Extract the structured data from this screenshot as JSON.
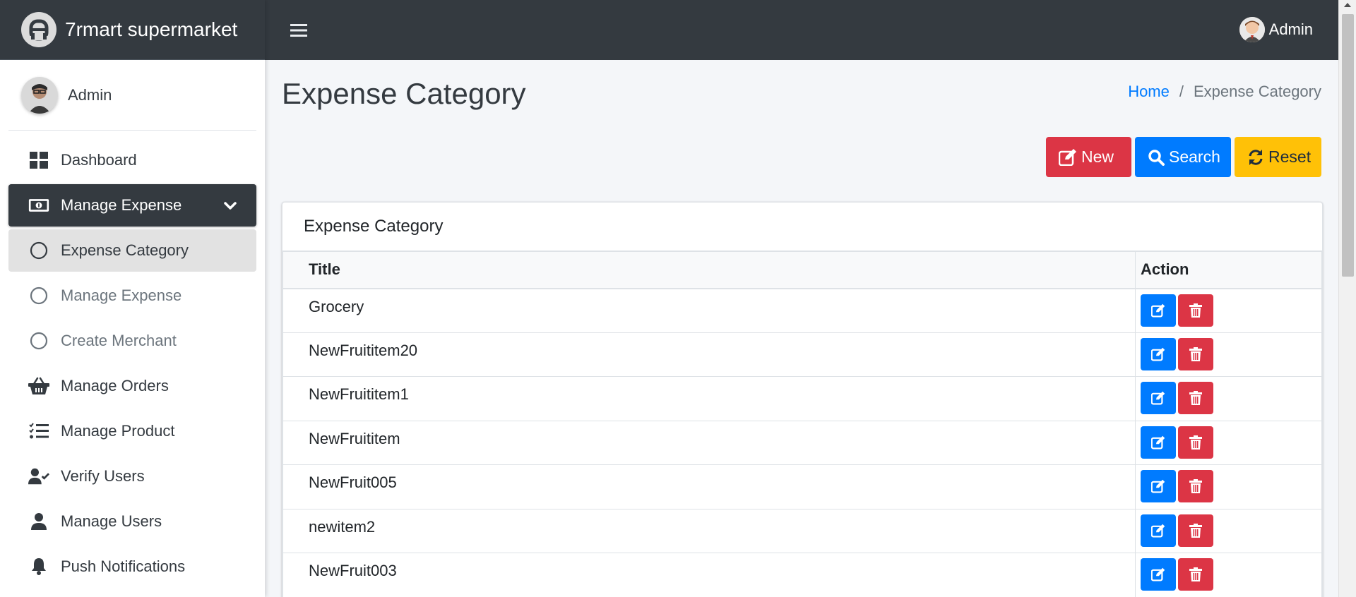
{
  "app": {
    "brand_name": "7rmart supermarket",
    "logo_icon": "brand-logo-icon",
    "header_user": "Admin"
  },
  "sidebar": {
    "user_name": "Admin",
    "items": [
      {
        "label": "Dashboard",
        "icon": "dashboard-icon"
      },
      {
        "label": "Manage Expense",
        "icon": "money-bill-icon",
        "state": "active",
        "expanded": true
      },
      {
        "label": "Expense Category",
        "icon": "circle-icon",
        "state": "selected",
        "submenu": true
      },
      {
        "label": "Manage Expense",
        "icon": "circle-icon",
        "submenu": true
      },
      {
        "label": "Create Merchant",
        "icon": "circle-icon",
        "submenu": true
      },
      {
        "label": "Manage Orders",
        "icon": "basket-icon"
      },
      {
        "label": "Manage Product",
        "icon": "tasks-icon"
      },
      {
        "label": "Verify Users",
        "icon": "user-check-icon"
      },
      {
        "label": "Manage Users",
        "icon": "user-icon"
      },
      {
        "label": "Push Notifications",
        "icon": "bell-icon"
      }
    ]
  },
  "page": {
    "title": "Expense Category",
    "breadcrumb": {
      "home": "Home",
      "separator": "/",
      "current": "Expense Category"
    }
  },
  "actions": {
    "new_label": "New",
    "search_label": "Search",
    "reset_label": "Reset"
  },
  "card": {
    "header": "Expense Category",
    "columns": [
      "Title",
      "Action"
    ],
    "rows": [
      {
        "title": "Grocery"
      },
      {
        "title": "NewFruititem20"
      },
      {
        "title": "NewFruititem1"
      },
      {
        "title": "NewFruititem"
      },
      {
        "title": "NewFruit005"
      },
      {
        "title": "newitem2"
      },
      {
        "title": "NewFruit003"
      }
    ]
  },
  "colors": {
    "header_bg": "#343a40",
    "primary": "#007bff",
    "danger": "#dc3545",
    "warning": "#ffc107",
    "page_bg": "#f4f6f9"
  }
}
